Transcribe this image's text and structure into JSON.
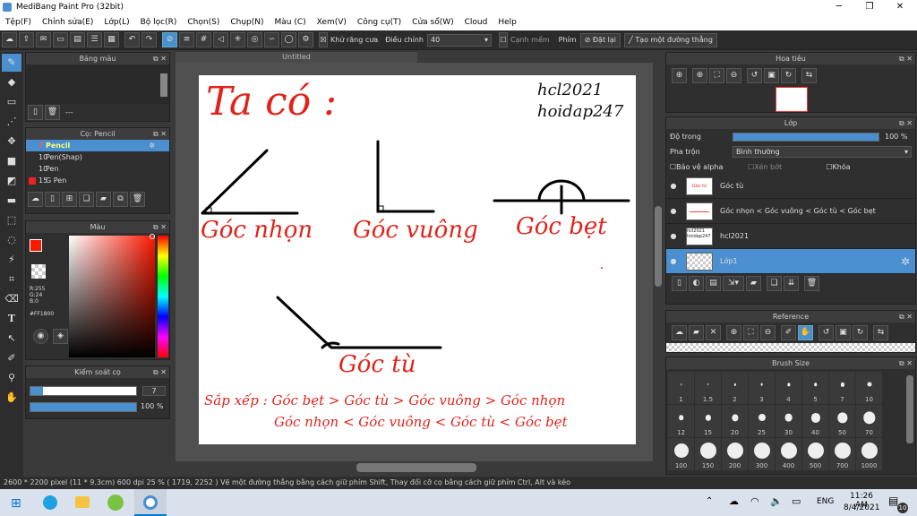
{
  "window": {
    "title": "MediBang Paint Pro (32bit)"
  },
  "menu": [
    "Tệp(F)",
    "Chỉnh sửa(E)",
    "Lớp(L)",
    "Bộ lọc(R)",
    "Chọn(S)",
    "Chụp(N)",
    "Màu (C)",
    "Xem(V)",
    "Công cụ(T)",
    "Cửa sổ(W)",
    "Cloud",
    "Help"
  ],
  "toolbar": {
    "antialias_label": "Khử răng cưa",
    "correction_label": "Điều chỉnh",
    "correction_value": "40",
    "smooth_label": "Cạnh mềm",
    "key_label": "Phím",
    "reset_label": "Đặt lại",
    "straight_label": "Tạo một đường thẳng"
  },
  "palette": {
    "title": "Bảng màu",
    "footer": "---"
  },
  "brushes": {
    "title": "Cọ: Pencil",
    "items": [
      {
        "size": "7",
        "name": "Pencil"
      },
      {
        "size": "10",
        "name": "Pen(Shap)"
      },
      {
        "size": "10",
        "name": "Pen"
      },
      {
        "size": "15",
        "name": "G Pen"
      }
    ]
  },
  "color": {
    "title": "Màu",
    "r": "R:255",
    "g": "G:24",
    "b": "B:0",
    "hex": "#FF1800",
    "primary": "#ff1800"
  },
  "brush_control": {
    "title": "Kiểm soát cọ",
    "size": "7",
    "opacity": "100 %"
  },
  "canvas": {
    "tab": "Untitled",
    "ta_co": "Ta có :",
    "user": "hcl2021",
    "site": "hoidap247",
    "goc_nhon": "Góc nhọn",
    "goc_vuong": "Góc vuông",
    "goc_bet": "Góc bẹt",
    "goc_tu": "Góc tù",
    "sort1": "Sắp xếp : Góc bẹt > Góc tù > Góc vuông > Góc nhọn",
    "sort2": "Góc nhọn < Góc vuông < Góc tù < Góc bẹt"
  },
  "navigator": {
    "title": "Hoa tiêu"
  },
  "layers": {
    "title": "Lớp",
    "opacity_label": "Độ trong",
    "opacity_value": "100 %",
    "opacity_pct": 100,
    "blend_label": "Pha trộn",
    "blend_value": "Bình thường",
    "protect_alpha": "Bảo vệ alpha",
    "clipping": "Xén bớt",
    "lock": "Khóa",
    "items": [
      {
        "name": "Góc tù",
        "thumb": "Góc tù"
      },
      {
        "name": "Góc nhọn < Góc vuông < Góc tù < Góc bẹt",
        "thumb": ""
      },
      {
        "name": "hcl2021",
        "thumb": "hcl2021 hoidap247"
      },
      {
        "name": "Lớp1",
        "thumb": ""
      }
    ]
  },
  "reference": {
    "title": "Reference"
  },
  "brush_size": {
    "title": "Brush Size",
    "sizes": [
      "1",
      "1.5",
      "2",
      "3",
      "4",
      "5",
      "7",
      "10",
      "12",
      "15",
      "20",
      "25",
      "30",
      "40",
      "50",
      "70",
      "100",
      "150",
      "200",
      "300",
      "400",
      "500",
      "700",
      "1000"
    ]
  },
  "status": {
    "text": "2600 * 2200 pixel   (11 * 9.3cm)   600 dpi   25 %   ( 1719, 2252 )   Vẽ một đường thẳng bằng cách giữ phím Shift, Thay đổi cỡ cọ bằng cách giữ phím Ctrl, Alt và kéo"
  },
  "taskbar": {
    "lang": "ENG",
    "time": "11:26 AM",
    "date": "8/4/2021",
    "notif": "10"
  }
}
